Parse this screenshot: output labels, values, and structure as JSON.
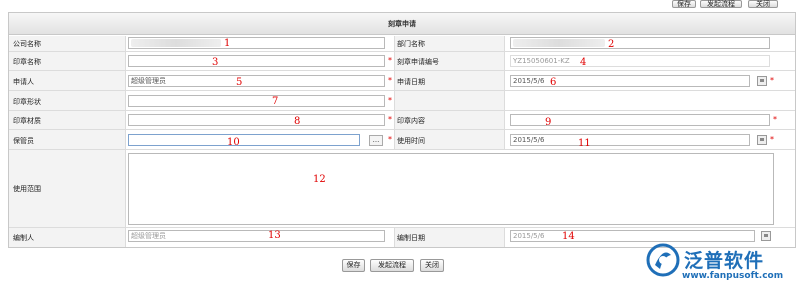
{
  "toolbar": {
    "save": "保存",
    "start_flow": "发起流程",
    "close": "关闭"
  },
  "form": {
    "title": "刻章申请",
    "fields": {
      "company": {
        "label": "公司名称",
        "value": "",
        "marker": "1"
      },
      "department": {
        "label": "部门名称",
        "value": "",
        "marker": "2"
      },
      "seal_name": {
        "label": "印章名称",
        "value": "",
        "marker": "3"
      },
      "apply_no": {
        "label": "刻章申请编号",
        "value": "YZ15050601-KZ",
        "marker": "4"
      },
      "applicant": {
        "label": "申请人",
        "value": "超级管理员",
        "marker": "5"
      },
      "apply_date": {
        "label": "申请日期",
        "value": "2015/5/6",
        "marker": "6"
      },
      "seal_shape": {
        "label": "印章形状",
        "value": "",
        "marker": "7"
      },
      "seal_material": {
        "label": "印章材质",
        "value": "",
        "marker": "8"
      },
      "seal_content": {
        "label": "印章内容",
        "value": "",
        "marker": "9"
      },
      "custodian": {
        "label": "保管员",
        "value": "",
        "button": "...",
        "marker": "10"
      },
      "use_time": {
        "label": "使用时间",
        "value": "2015/5/6",
        "marker": "11"
      },
      "use_scope": {
        "label": "使用范围",
        "value": "",
        "marker": "12"
      },
      "author": {
        "label": "编制人",
        "value": "超级管理员",
        "marker": "13"
      },
      "author_date": {
        "label": "编制日期",
        "value": "2015/5/6",
        "marker": "14"
      }
    },
    "required_mark": "*"
  },
  "footer": {
    "save": "保存",
    "start_flow": "发起流程",
    "close": "关闭"
  },
  "brand": {
    "name": "泛普软件",
    "url": "www.fanpusoft.com",
    "color": "#1f6fb8"
  },
  "colors": {
    "required": "#e00000",
    "marker": "#e00000",
    "border": "#c8c8c8"
  }
}
